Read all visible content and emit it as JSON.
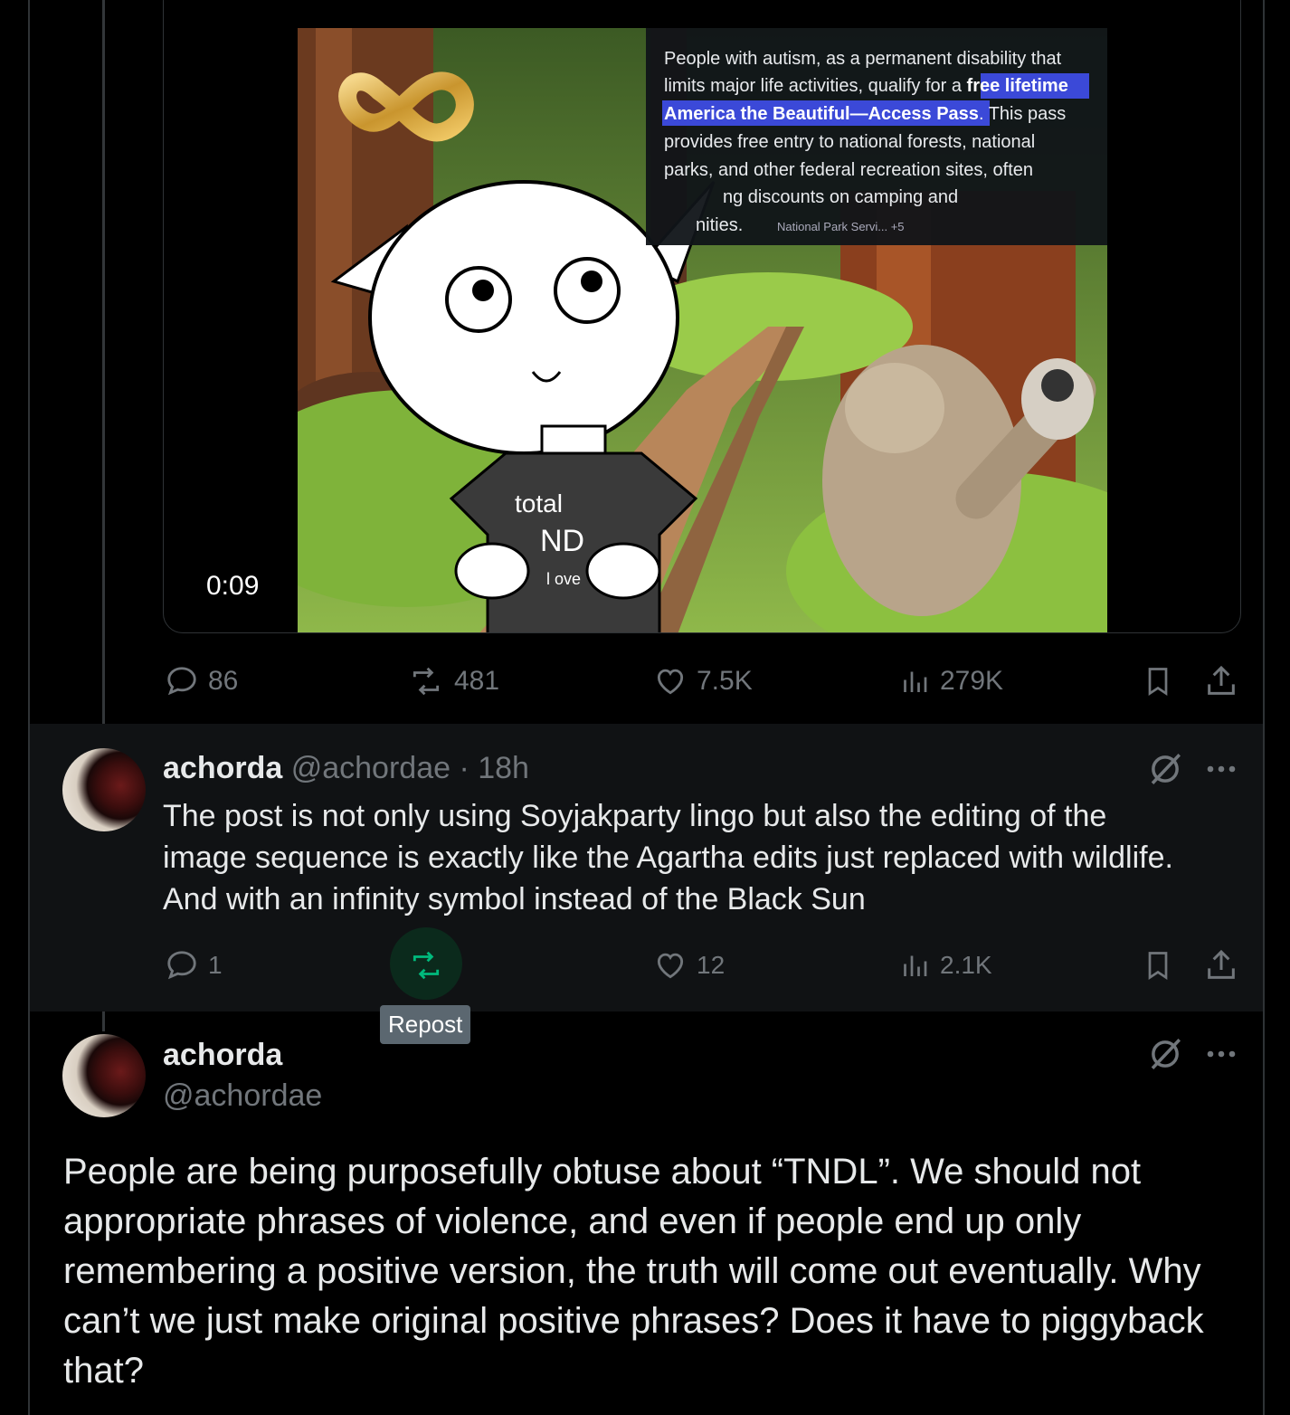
{
  "video": {
    "timestamp": "0:09",
    "overlay_text": {
      "line1": "People with autism, as a permanent disability that",
      "line2a": "limits major life activities, qualify for a ",
      "line2b": "free lifetime",
      "line3a": "America the Beautiful—Access Pass",
      "line3b": ". This pass",
      "line4": "provides free entry to national forests, national",
      "line5": "parks, and other federal recreation sites, often",
      "line6": "ng discounts on camping and",
      "line7": "nities.",
      "source": "National Park Servi... +5"
    },
    "shirt_text": {
      "line1": "total",
      "line2": "ND",
      "line3": "l ove"
    }
  },
  "post_actions": {
    "replies": "86",
    "reposts": "481",
    "likes": "7.5K",
    "views": "279K"
  },
  "reply": {
    "name": "achorda",
    "handle": "@achordae · 18h",
    "lines": [
      "The post is not only using Soyjakparty lingo but also the editing of the",
      "image sequence is exactly like the Agartha edits just replaced with wildlife.",
      "And with an infinity symbol instead of the Black Sun"
    ],
    "actions": {
      "replies": "1",
      "likes": "12",
      "views": "2.1K"
    },
    "tooltip": "Repost"
  },
  "main_post": {
    "name": "achorda",
    "handle": "@achordae",
    "text": "People are being purposefully obtuse about “TNDL”. We should not appropriate phrases of violence, and even if people end up only remembering a positive version, the truth will come out eventually. Why can’t we just make original positive phrases? Does it have to piggyback that?"
  },
  "colors": {
    "background": "#000000",
    "text": "#e7e9ea",
    "muted": "#71767b",
    "repost_green": "#00ba7c",
    "reply_bg": "#101214"
  }
}
